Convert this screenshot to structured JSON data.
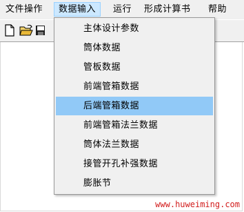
{
  "menubar": {
    "items": [
      {
        "label": "文件操作"
      },
      {
        "label": "数据输入"
      },
      {
        "label": "运行"
      },
      {
        "label": "形成计算书"
      },
      {
        "label": "帮助"
      }
    ]
  },
  "toolbar": {
    "buttons": [
      {
        "icon": "new-file-icon"
      },
      {
        "icon": "open-folder-icon"
      },
      {
        "icon": "save-icon"
      }
    ]
  },
  "dropdown": {
    "items": [
      {
        "label": "主体设计参数"
      },
      {
        "label": "筒体数据"
      },
      {
        "label": "管板数据"
      },
      {
        "label": "前端管箱数据"
      },
      {
        "label": "后端管箱数据"
      },
      {
        "label": "前端管箱法兰数据"
      },
      {
        "label": "筒体法兰数据"
      },
      {
        "label": "接管开孔补强数据"
      },
      {
        "label": "膨胀节"
      }
    ],
    "selected_index": 4
  },
  "watermark": {
    "text": "www.huweiming.com"
  },
  "colors": {
    "menu_open_bg": "#cce8ff",
    "selected_item_bg": "#91c9f7",
    "watermark": "#d21c1c"
  }
}
